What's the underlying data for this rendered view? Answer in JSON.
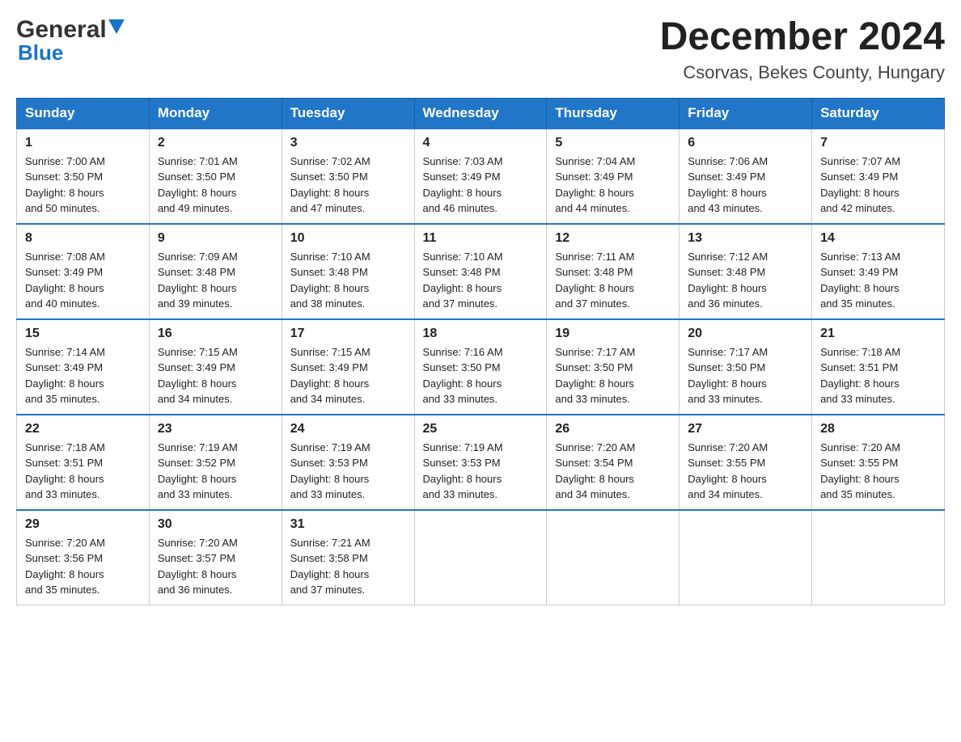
{
  "logo": {
    "general": "General",
    "blue": "Blue",
    "tagline": "GeneralBlue"
  },
  "title": "December 2024",
  "subtitle": "Csorvas, Bekes County, Hungary",
  "days_of_week": [
    "Sunday",
    "Monday",
    "Tuesday",
    "Wednesday",
    "Thursday",
    "Friday",
    "Saturday"
  ],
  "weeks": [
    [
      {
        "day": "1",
        "sunrise": "7:00 AM",
        "sunset": "3:50 PM",
        "daylight": "8 hours and 50 minutes."
      },
      {
        "day": "2",
        "sunrise": "7:01 AM",
        "sunset": "3:50 PM",
        "daylight": "8 hours and 49 minutes."
      },
      {
        "day": "3",
        "sunrise": "7:02 AM",
        "sunset": "3:50 PM",
        "daylight": "8 hours and 47 minutes."
      },
      {
        "day": "4",
        "sunrise": "7:03 AM",
        "sunset": "3:49 PM",
        "daylight": "8 hours and 46 minutes."
      },
      {
        "day": "5",
        "sunrise": "7:04 AM",
        "sunset": "3:49 PM",
        "daylight": "8 hours and 44 minutes."
      },
      {
        "day": "6",
        "sunrise": "7:06 AM",
        "sunset": "3:49 PM",
        "daylight": "8 hours and 43 minutes."
      },
      {
        "day": "7",
        "sunrise": "7:07 AM",
        "sunset": "3:49 PM",
        "daylight": "8 hours and 42 minutes."
      }
    ],
    [
      {
        "day": "8",
        "sunrise": "7:08 AM",
        "sunset": "3:49 PM",
        "daylight": "8 hours and 40 minutes."
      },
      {
        "day": "9",
        "sunrise": "7:09 AM",
        "sunset": "3:48 PM",
        "daylight": "8 hours and 39 minutes."
      },
      {
        "day": "10",
        "sunrise": "7:10 AM",
        "sunset": "3:48 PM",
        "daylight": "8 hours and 38 minutes."
      },
      {
        "day": "11",
        "sunrise": "7:10 AM",
        "sunset": "3:48 PM",
        "daylight": "8 hours and 37 minutes."
      },
      {
        "day": "12",
        "sunrise": "7:11 AM",
        "sunset": "3:48 PM",
        "daylight": "8 hours and 37 minutes."
      },
      {
        "day": "13",
        "sunrise": "7:12 AM",
        "sunset": "3:48 PM",
        "daylight": "8 hours and 36 minutes."
      },
      {
        "day": "14",
        "sunrise": "7:13 AM",
        "sunset": "3:49 PM",
        "daylight": "8 hours and 35 minutes."
      }
    ],
    [
      {
        "day": "15",
        "sunrise": "7:14 AM",
        "sunset": "3:49 PM",
        "daylight": "8 hours and 35 minutes."
      },
      {
        "day": "16",
        "sunrise": "7:15 AM",
        "sunset": "3:49 PM",
        "daylight": "8 hours and 34 minutes."
      },
      {
        "day": "17",
        "sunrise": "7:15 AM",
        "sunset": "3:49 PM",
        "daylight": "8 hours and 34 minutes."
      },
      {
        "day": "18",
        "sunrise": "7:16 AM",
        "sunset": "3:50 PM",
        "daylight": "8 hours and 33 minutes."
      },
      {
        "day": "19",
        "sunrise": "7:17 AM",
        "sunset": "3:50 PM",
        "daylight": "8 hours and 33 minutes."
      },
      {
        "day": "20",
        "sunrise": "7:17 AM",
        "sunset": "3:50 PM",
        "daylight": "8 hours and 33 minutes."
      },
      {
        "day": "21",
        "sunrise": "7:18 AM",
        "sunset": "3:51 PM",
        "daylight": "8 hours and 33 minutes."
      }
    ],
    [
      {
        "day": "22",
        "sunrise": "7:18 AM",
        "sunset": "3:51 PM",
        "daylight": "8 hours and 33 minutes."
      },
      {
        "day": "23",
        "sunrise": "7:19 AM",
        "sunset": "3:52 PM",
        "daylight": "8 hours and 33 minutes."
      },
      {
        "day": "24",
        "sunrise": "7:19 AM",
        "sunset": "3:53 PM",
        "daylight": "8 hours and 33 minutes."
      },
      {
        "day": "25",
        "sunrise": "7:19 AM",
        "sunset": "3:53 PM",
        "daylight": "8 hours and 33 minutes."
      },
      {
        "day": "26",
        "sunrise": "7:20 AM",
        "sunset": "3:54 PM",
        "daylight": "8 hours and 34 minutes."
      },
      {
        "day": "27",
        "sunrise": "7:20 AM",
        "sunset": "3:55 PM",
        "daylight": "8 hours and 34 minutes."
      },
      {
        "day": "28",
        "sunrise": "7:20 AM",
        "sunset": "3:55 PM",
        "daylight": "8 hours and 35 minutes."
      }
    ],
    [
      {
        "day": "29",
        "sunrise": "7:20 AM",
        "sunset": "3:56 PM",
        "daylight": "8 hours and 35 minutes."
      },
      {
        "day": "30",
        "sunrise": "7:20 AM",
        "sunset": "3:57 PM",
        "daylight": "8 hours and 36 minutes."
      },
      {
        "day": "31",
        "sunrise": "7:21 AM",
        "sunset": "3:58 PM",
        "daylight": "8 hours and 37 minutes."
      },
      null,
      null,
      null,
      null
    ]
  ],
  "labels": {
    "sunrise": "Sunrise:",
    "sunset": "Sunset:",
    "daylight": "Daylight:"
  }
}
